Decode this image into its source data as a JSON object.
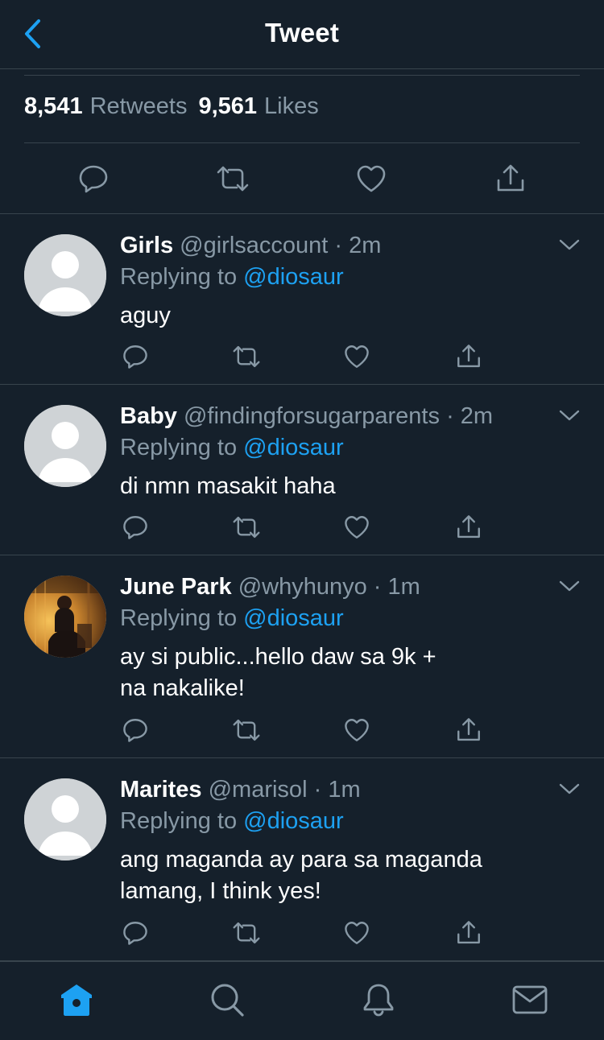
{
  "header": {
    "title": "Tweet",
    "back_icon": "chevron-left-icon"
  },
  "stats": {
    "retweets_count": "8,541",
    "retweets_label": "Retweets",
    "likes_count": "9,561",
    "likes_label": "Likes"
  },
  "colors": {
    "background": "#15202b",
    "divider": "#38444d",
    "muted": "#8899a6",
    "accent": "#1da1f2"
  },
  "replies": [
    {
      "name": "Girls",
      "handle": "@girlsaccount",
      "dot": "·",
      "time": "2m",
      "replying_prefix": "Replying to",
      "replying_to": "@diosaur",
      "text": "aguy",
      "avatar": "default-avatar-icon"
    },
    {
      "name": "Baby",
      "handle": "@findingforsugarparents",
      "dot": "·",
      "time": "2m",
      "replying_prefix": "Replying to",
      "replying_to": "@diosaur",
      "text": "di nmn masakit haha",
      "avatar": "default-avatar-icon"
    },
    {
      "name": "June Park",
      "handle": "@whyhunyo",
      "dot": "·",
      "time": "1m",
      "replying_prefix": "Replying to",
      "replying_to": "@diosaur",
      "text": "ay si public...hello daw sa 9k +\nna nakalike!",
      "avatar": "photo-avatar"
    },
    {
      "name": "Marites",
      "handle": "@marisol",
      "dot": "·",
      "time": "1m",
      "replying_prefix": "Replying to",
      "replying_to": "@diosaur",
      "text": "ang maganda ay para sa maganda\nlamang, I think yes!",
      "avatar": "default-avatar-icon"
    }
  ],
  "tabs": [
    {
      "name": "home",
      "icon": "home-icon",
      "active": true
    },
    {
      "name": "search",
      "icon": "search-icon",
      "active": false
    },
    {
      "name": "notifications",
      "icon": "bell-icon",
      "active": false
    },
    {
      "name": "messages",
      "icon": "mail-icon",
      "active": false
    }
  ]
}
